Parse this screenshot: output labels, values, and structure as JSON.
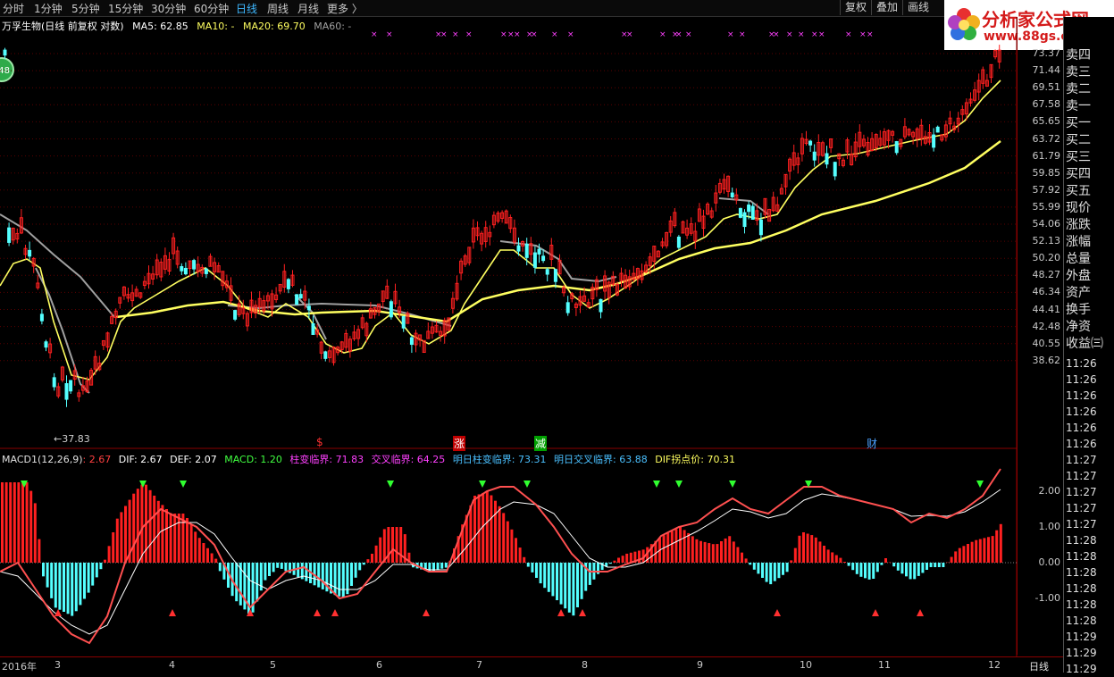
{
  "toolbar": {
    "timeframes": [
      "分时",
      "1分钟",
      "5分钟",
      "15分钟",
      "30分钟",
      "60分钟",
      "日线",
      "周线",
      "月线",
      "更多 〉"
    ],
    "active_timeframe": "日线",
    "right_buttons": [
      "复权",
      "叠加",
      "画线"
    ]
  },
  "info": {
    "title": "万孚生物(日线 前复权 对数)",
    "ma5": "MA5: 62.85",
    "ma10": "MA10: -",
    "ma20": "MA20: 69.70",
    "ma60": "MA60: -"
  },
  "badge": "48",
  "logo": {
    "name": "分析家公式网",
    "url": "www.88gs.com"
  },
  "price_axis": [
    "73.37",
    "71.44",
    "69.51",
    "67.58",
    "65.65",
    "63.72",
    "61.79",
    "59.85",
    "57.92",
    "55.99",
    "54.06",
    "52.13",
    "50.20",
    "48.27",
    "46.34",
    "44.41",
    "42.48",
    "40.55",
    "38.62"
  ],
  "low_marker": "←37.83",
  "events": [
    {
      "label": "$",
      "color": "#ff3030"
    },
    {
      "label": "涨",
      "color": "#ffffff",
      "bg": "#c00000"
    },
    {
      "label": "减",
      "color": "#ffffff",
      "bg": "#00a000"
    },
    {
      "label": "财",
      "color": "#4aa0ff"
    }
  ],
  "macd": {
    "name": "MACD1(12,26,9)",
    "value": ": 2.67",
    "dif": "DIF: 2.67",
    "def": "DEF: 2.07",
    "macd": "MACD: 1.20",
    "t1": "柱变临界: 71.83",
    "t2": "交叉临界: 64.25",
    "t3": "明日柱变临界: 73.31",
    "t4": "明日交叉临界: 63.88",
    "t5": "DIF拐点价: 70.31",
    "axis": [
      "2.00",
      "1.00",
      "0.00",
      "-1.00"
    ]
  },
  "date_axis": [
    "2016年",
    "3",
    "4",
    "5",
    "6",
    "7",
    "8",
    "9",
    "10",
    "11",
    "12"
  ],
  "bottom_right": "日线",
  "side_panel": {
    "labels": [
      "卖四",
      "卖三",
      "卖二",
      "卖一",
      "买一",
      "买二",
      "买三",
      "买四",
      "买五",
      "现价",
      "涨跌",
      "涨幅",
      "总量",
      "外盘",
      "资产",
      "换手",
      "净资",
      "收益㈢"
    ],
    "times": [
      "11:26",
      "11:26",
      "11:26",
      "11:26",
      "11:26",
      "11:26",
      "11:27",
      "11:27",
      "11:27",
      "11:27",
      "11:27",
      "11:28",
      "11:28",
      "11:28",
      "11:28",
      "11:28",
      "11:28",
      "11:29",
      "11:29",
      "11:29"
    ]
  },
  "colors": {
    "up": "#ff2020",
    "down": "#54ffff",
    "ma5": "#ffff60",
    "ma20": "#a0a0a0",
    "ma60": "#ffff60",
    "dif": "#ffffff",
    "dea": "#ff5050"
  }
}
